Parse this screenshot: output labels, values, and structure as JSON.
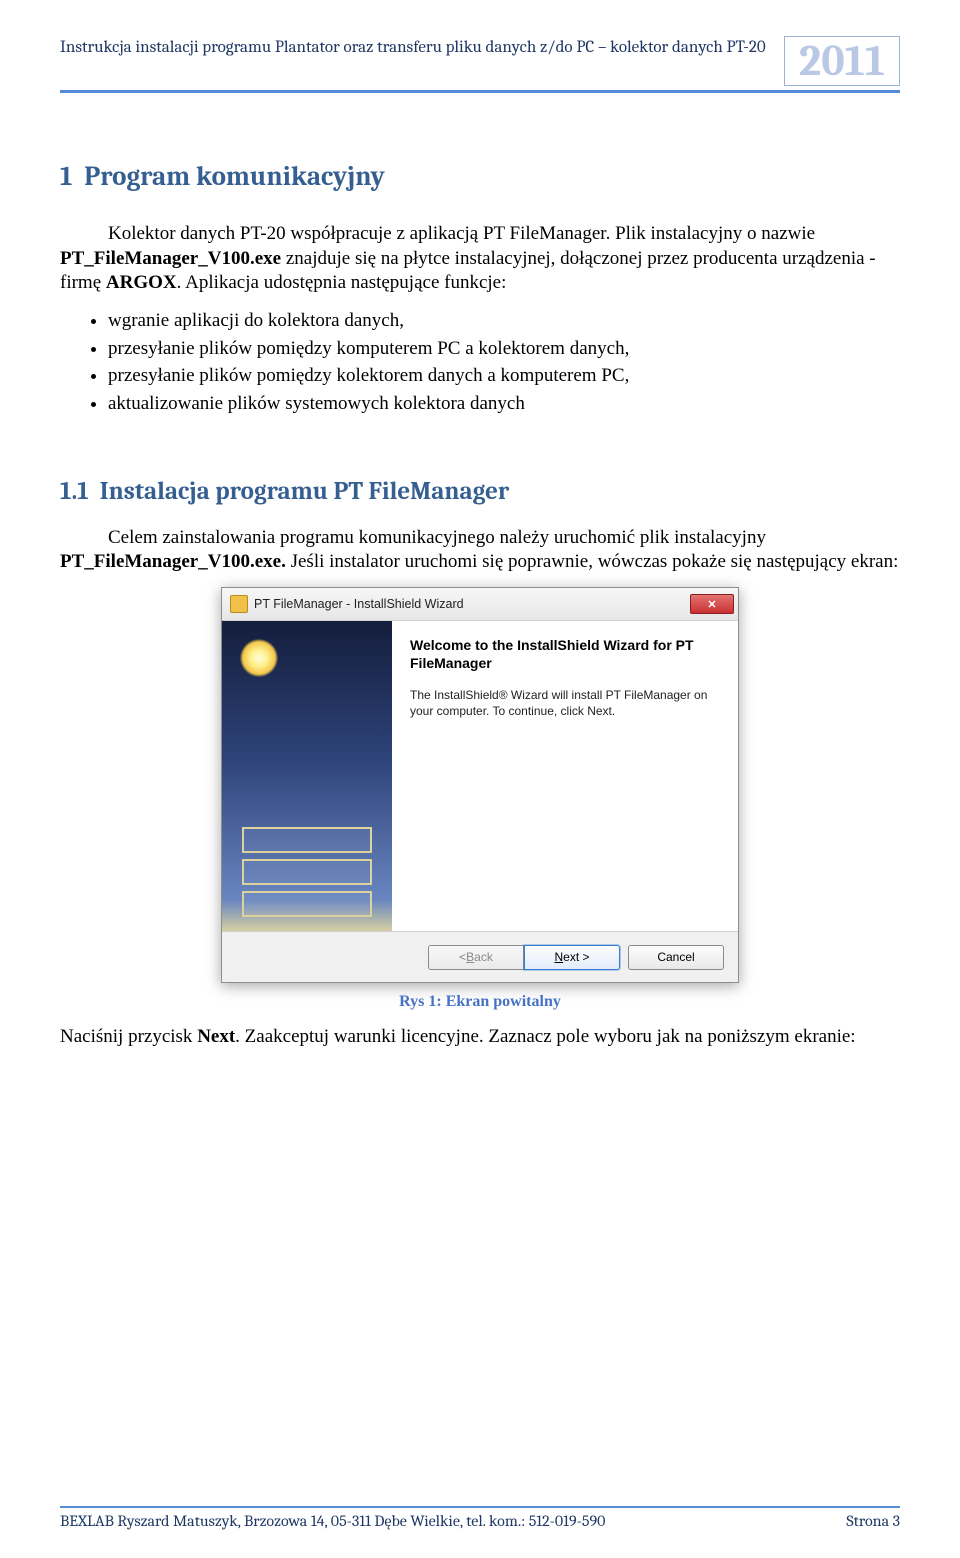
{
  "header": {
    "title": "Instrukcja instalacji programu Plantator oraz transferu pliku danych z/do PC – kolektor danych PT-20",
    "year": "2011"
  },
  "section1": {
    "number": "1",
    "title": "Program komunikacyjny",
    "p1a": "Kolektor danych PT-20 współpracuje z aplikacją PT FileManager. Plik instalacyjny o nazwie ",
    "p1b": "PT_FileManager_V100.exe",
    "p1c": " znajduje się na płytce instalacyjnej, dołączonej przez producenta urządzenia - firmę ",
    "p1d": "ARGOX",
    "p1e": ". Aplikacja udostępnia następujące funkcje:",
    "bullets": [
      "wgranie aplikacji do kolektora danych,",
      "przesyłanie plików pomiędzy komputerem PC a kolektorem danych,",
      "przesyłanie plików pomiędzy kolektorem danych a komputerem PC,",
      "aktualizowanie plików systemowych kolektora danych"
    ]
  },
  "section11": {
    "number": "1.1",
    "title": "Instalacja programu PT FileManager",
    "p1a": "Celem zainstalowania programu komunikacyjnego należy uruchomić plik instalacyjny ",
    "p1b": "PT_FileManager_V100.exe. ",
    "p1c": "Jeśli instalator uruchomi się poprawnie, wówczas pokaże się następujący ekran:"
  },
  "dialog": {
    "title": "PT FileManager - InstallShield Wizard",
    "welcome1": "Welcome to the InstallShield Wizard for PT",
    "welcome2": "FileManager",
    "desc": "The InstallShield® Wizard will install PT FileManager on your computer.  To continue, click Next.",
    "back_prefix": "< ",
    "back_u": "B",
    "back_rest": "ack",
    "next_u": "N",
    "next_rest": "ext >",
    "cancel": "Cancel"
  },
  "caption": "Rys 1: Ekran powitalny",
  "after": {
    "a": "Naciśnij przycisk ",
    "b": "Next",
    "c": ". Zaakceptuj warunki licencyjne. Zaznacz pole wyboru jak na poniższym ekranie:"
  },
  "footer": {
    "left": "BEXLAB Ryszard Matuszyk, Brzozowa 14, 05-311 Dębe Wielkie, tel. kom.: 512-019-590",
    "right": "Strona 3"
  }
}
